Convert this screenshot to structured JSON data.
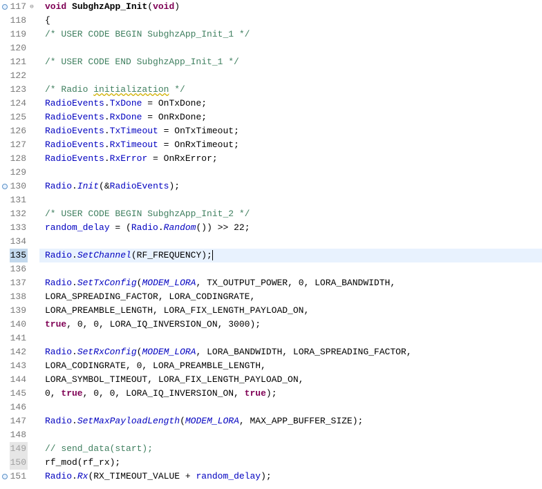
{
  "lines": [
    {
      "num": 117,
      "marker": "circle",
      "fold": "minus",
      "tokens": [
        [
          "k",
          "void"
        ],
        [
          "s",
          " "
        ],
        [
          "fn",
          "SubghzApp_Init"
        ],
        [
          "s",
          "("
        ],
        [
          "k",
          "void"
        ],
        [
          "s",
          ")"
        ]
      ]
    },
    {
      "num": 118,
      "tokens": [
        [
          "s",
          "{"
        ]
      ]
    },
    {
      "num": 119,
      "indent": 1,
      "tokens": [
        [
          "c",
          "/* USER CODE BEGIN SubghzApp_Init_1 */"
        ]
      ]
    },
    {
      "num": 120,
      "tokens": []
    },
    {
      "num": 121,
      "indent": 1,
      "tokens": [
        [
          "c",
          "/* USER CODE END SubghzApp_Init_1 */"
        ]
      ]
    },
    {
      "num": 122,
      "tokens": []
    },
    {
      "num": 123,
      "indent": 1,
      "tokens": [
        [
          "c",
          "/* Radio "
        ],
        [
          "cw",
          "initialization"
        ],
        [
          "c",
          " */"
        ]
      ]
    },
    {
      "num": 124,
      "indent": 1,
      "tokens": [
        [
          "fld",
          "RadioEvents"
        ],
        [
          "s",
          "."
        ],
        [
          "fld",
          "TxDone"
        ],
        [
          "s",
          " = OnTxDone;"
        ]
      ]
    },
    {
      "num": 125,
      "indent": 1,
      "tokens": [
        [
          "fld",
          "RadioEvents"
        ],
        [
          "s",
          "."
        ],
        [
          "fld",
          "RxDone"
        ],
        [
          "s",
          " = OnRxDone;"
        ]
      ]
    },
    {
      "num": 126,
      "indent": 1,
      "tokens": [
        [
          "fld",
          "RadioEvents"
        ],
        [
          "s",
          "."
        ],
        [
          "fld",
          "TxTimeout"
        ],
        [
          "s",
          " = OnTxTimeout;"
        ]
      ]
    },
    {
      "num": 127,
      "indent": 1,
      "tokens": [
        [
          "fld",
          "RadioEvents"
        ],
        [
          "s",
          "."
        ],
        [
          "fld",
          "RxTimeout"
        ],
        [
          "s",
          " = OnRxTimeout;"
        ]
      ]
    },
    {
      "num": 128,
      "indent": 1,
      "tokens": [
        [
          "fld",
          "RadioEvents"
        ],
        [
          "s",
          "."
        ],
        [
          "fld",
          "RxError"
        ],
        [
          "s",
          " = OnRxError;"
        ]
      ]
    },
    {
      "num": 129,
      "tokens": []
    },
    {
      "num": 130,
      "marker": "circle",
      "indent": 1,
      "tokens": [
        [
          "fld",
          "Radio"
        ],
        [
          "s",
          "."
        ],
        [
          "it",
          "Init"
        ],
        [
          "s",
          "(&"
        ],
        [
          "fld",
          "RadioEvents"
        ],
        [
          "s",
          ");"
        ]
      ]
    },
    {
      "num": 131,
      "tokens": []
    },
    {
      "num": 132,
      "indent": 1,
      "tokens": [
        [
          "c",
          "/* USER CODE BEGIN SubghzApp_Init_2 */"
        ]
      ]
    },
    {
      "num": 133,
      "indent": 1,
      "tokens": [
        [
          "fld",
          "random_delay"
        ],
        [
          "s",
          " = ("
        ],
        [
          "fld",
          "Radio"
        ],
        [
          "s",
          "."
        ],
        [
          "it",
          "Random"
        ],
        [
          "s",
          "()) >> 22;"
        ]
      ]
    },
    {
      "num": 134,
      "tokens": []
    },
    {
      "num": 135,
      "highlight": true,
      "dirty": true,
      "indent": 1,
      "tokens": [
        [
          "fld",
          "Radio"
        ],
        [
          "s",
          "."
        ],
        [
          "it",
          "SetChannel"
        ],
        [
          "s",
          "(RF_FREQUENCY);"
        ]
      ],
      "cursor": true
    },
    {
      "num": 136,
      "tokens": []
    },
    {
      "num": 137,
      "indent": 1,
      "tokens": [
        [
          "fld",
          "Radio"
        ],
        [
          "s",
          "."
        ],
        [
          "it",
          "SetTxConfig"
        ],
        [
          "s",
          "("
        ],
        [
          "it",
          "MODEM_LORA"
        ],
        [
          "s",
          ", TX_OUTPUT_POWER, 0, LORA_BANDWIDTH,"
        ]
      ]
    },
    {
      "num": 138,
      "indent": 0,
      "tokens": [
        [
          "s",
          "                    LORA_SPREADING_FACTOR, LORA_CODINGRATE,"
        ]
      ]
    },
    {
      "num": 139,
      "indent": 0,
      "tokens": [
        [
          "s",
          "                    LORA_PREAMBLE_LENGTH, LORA_FIX_LENGTH_PAYLOAD_ON,"
        ]
      ]
    },
    {
      "num": 140,
      "indent": 0,
      "tokens": [
        [
          "k",
          "                    true"
        ],
        [
          "s",
          ", 0, 0, LORA_IQ_INVERSION_ON, 3000);"
        ]
      ]
    },
    {
      "num": 141,
      "tokens": []
    },
    {
      "num": 142,
      "indent": 1,
      "tokens": [
        [
          "fld",
          "Radio"
        ],
        [
          "s",
          "."
        ],
        [
          "it",
          "SetRxConfig"
        ],
        [
          "s",
          "("
        ],
        [
          "it",
          "MODEM_LORA"
        ],
        [
          "s",
          ", LORA_BANDWIDTH, LORA_SPREADING_FACTOR,"
        ]
      ]
    },
    {
      "num": 143,
      "indent": 0,
      "tokens": [
        [
          "s",
          "                    LORA_CODINGRATE, 0, LORA_PREAMBLE_LENGTH,"
        ]
      ]
    },
    {
      "num": 144,
      "indent": 0,
      "tokens": [
        [
          "s",
          "                    LORA_SYMBOL_TIMEOUT, LORA_FIX_LENGTH_PAYLOAD_ON,"
        ]
      ]
    },
    {
      "num": 145,
      "indent": 0,
      "tokens": [
        [
          "s",
          "                    0, "
        ],
        [
          "k",
          "true"
        ],
        [
          "s",
          ", 0, 0, LORA_IQ_INVERSION_ON, "
        ],
        [
          "k",
          "true"
        ],
        [
          "s",
          ");"
        ]
      ]
    },
    {
      "num": 146,
      "tokens": []
    },
    {
      "num": 147,
      "indent": 1,
      "tokens": [
        [
          "fld",
          "Radio"
        ],
        [
          "s",
          "."
        ],
        [
          "it",
          "SetMaxPayloadLength"
        ],
        [
          "s",
          "("
        ],
        [
          "it",
          "MODEM_LORA"
        ],
        [
          "s",
          ", MAX_APP_BUFFER_SIZE);"
        ]
      ]
    },
    {
      "num": 148,
      "tokens": []
    },
    {
      "num": 149,
      "grey": true,
      "indent": 1,
      "tokens": [
        [
          "c",
          "// send_data(start);"
        ]
      ]
    },
    {
      "num": 150,
      "grey": true,
      "indent": 1,
      "tokens": [
        [
          "s",
          "rf_mod(rf_rx);"
        ]
      ]
    },
    {
      "num": 151,
      "marker": "circle",
      "indent": 1,
      "tokens": [
        [
          "fld",
          "Radio"
        ],
        [
          "s",
          "."
        ],
        [
          "it",
          "Rx"
        ],
        [
          "s",
          "(RX_TIMEOUT_VALUE + "
        ],
        [
          "fld",
          "random_delay"
        ],
        [
          "s",
          ");"
        ]
      ]
    }
  ]
}
